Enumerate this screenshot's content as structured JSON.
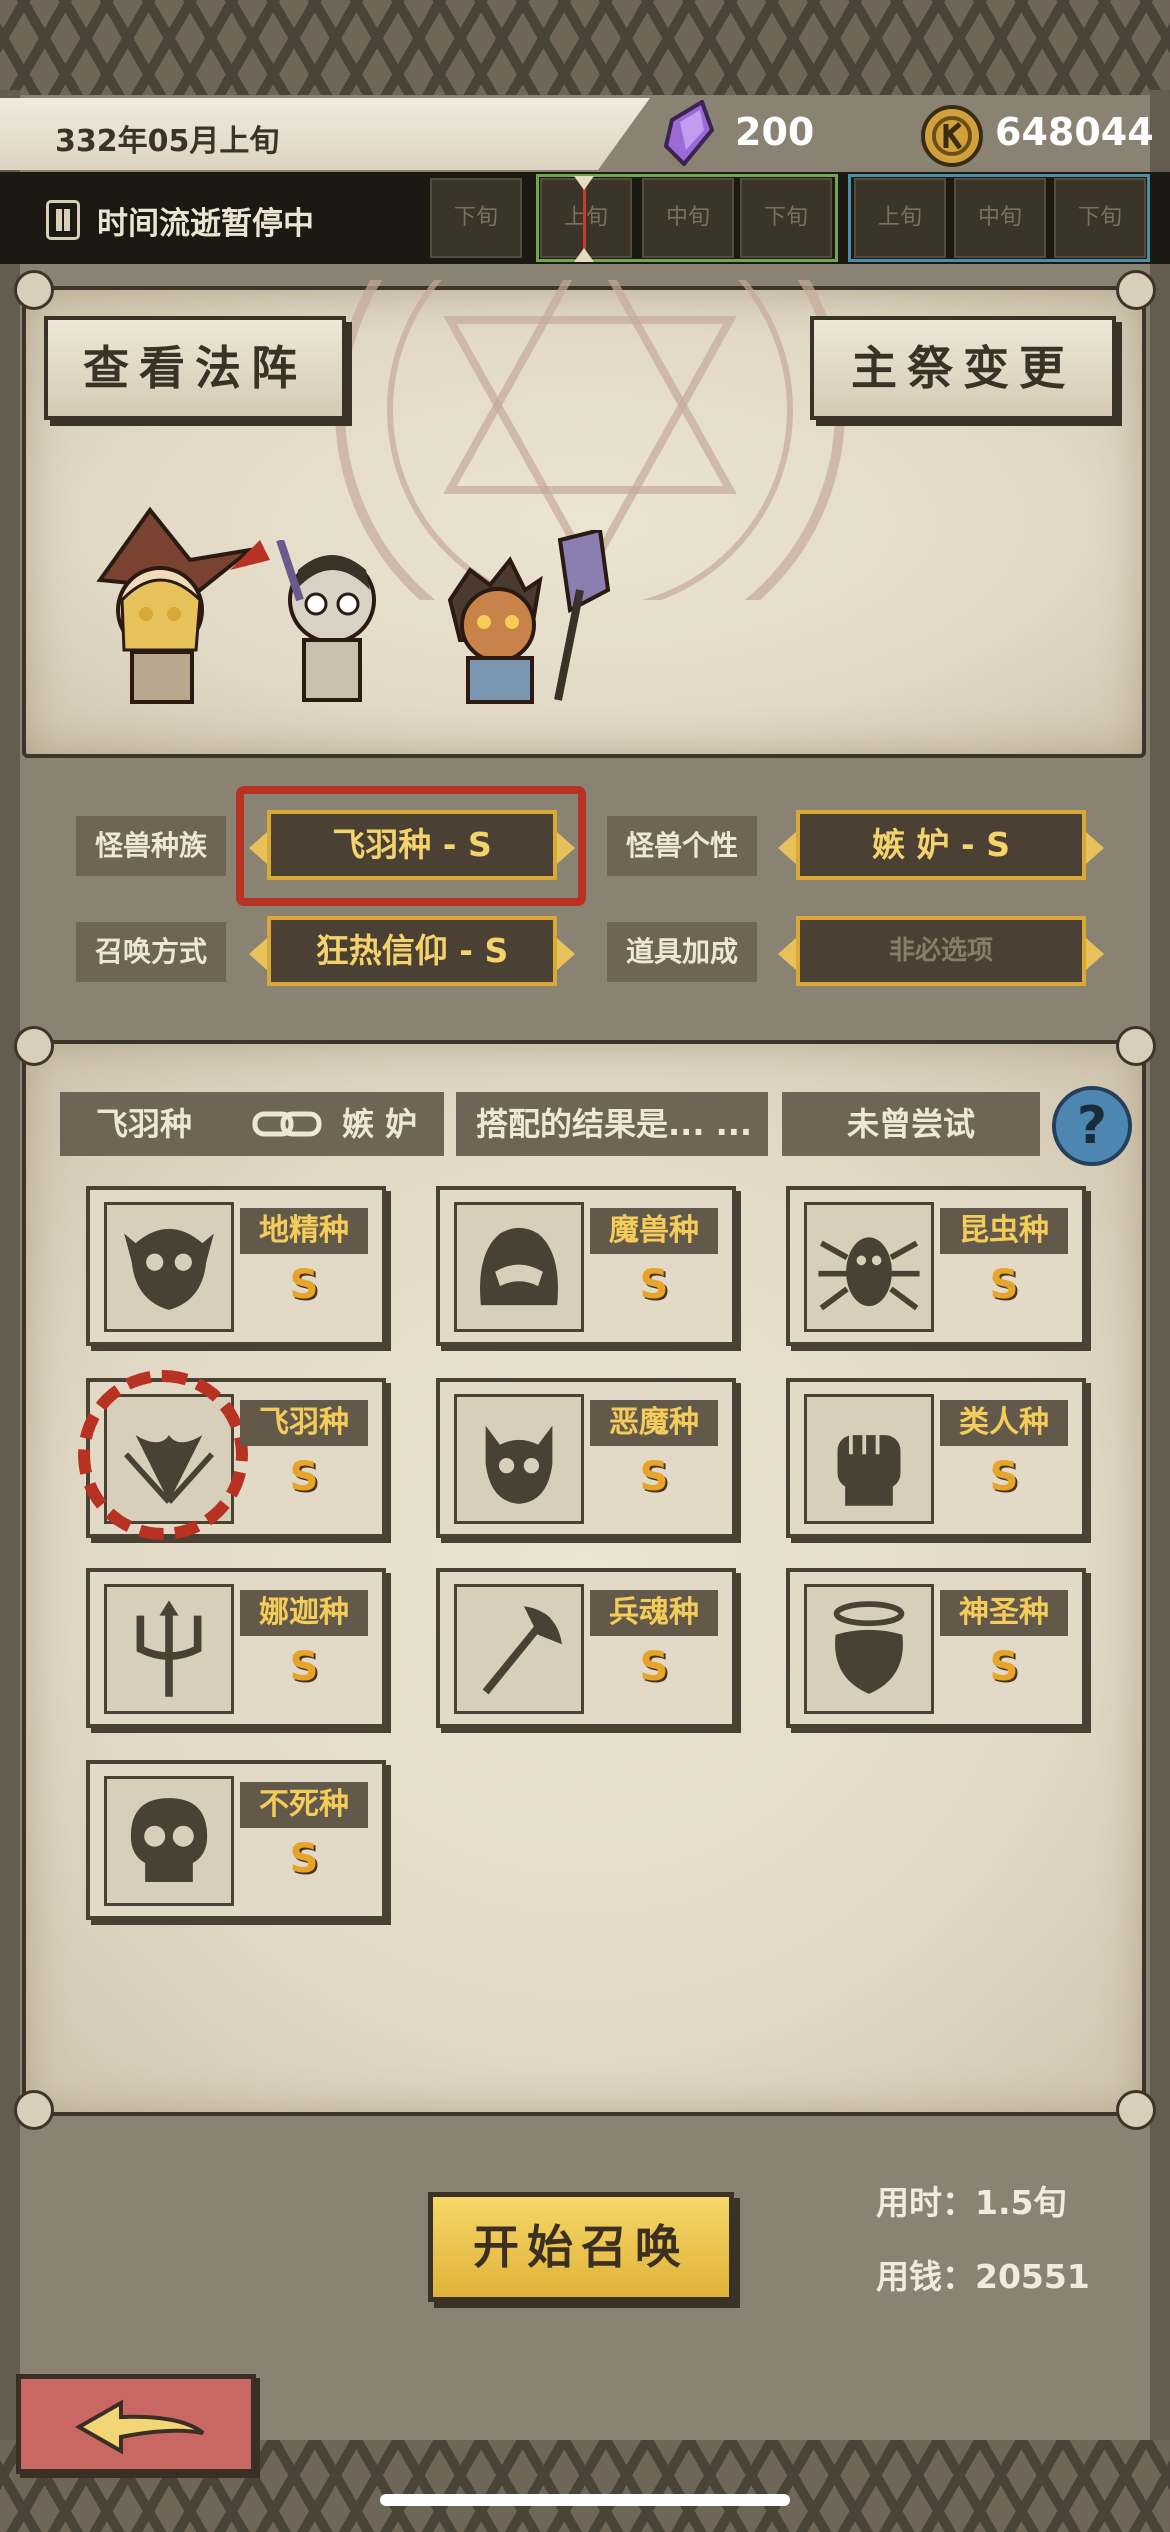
{
  "header": {
    "date": "332年05月上旬",
    "gems": "200",
    "coins": "648044"
  },
  "timebar": {
    "status": "时间流逝暂停中",
    "slots": [
      "下旬",
      "上旬",
      "中旬",
      "下旬",
      "上旬",
      "中旬",
      "下旬"
    ]
  },
  "altar": {
    "view_array_label": "查看法阵",
    "change_priest_label": "主祭变更"
  },
  "selectors": {
    "race_label": "怪兽种族",
    "race_value": "飞羽种 - S",
    "personality_label": "怪兽个性",
    "personality_value": "嫉 妒 - S",
    "method_label": "召唤方式",
    "method_value": "狂热信仰 - S",
    "item_label": "道具加成",
    "item_value": "非必选项"
  },
  "combo": {
    "left": "飞羽种",
    "right": "嫉 妒",
    "result": "搭配的结果是... ...",
    "status": "未曾尝试",
    "help": "?"
  },
  "species": [
    {
      "name": "地精种",
      "rank": "S",
      "icon": "goblin-icon"
    },
    {
      "name": "魔兽种",
      "rank": "S",
      "icon": "beast-icon"
    },
    {
      "name": "昆虫种",
      "rank": "S",
      "icon": "insect-icon"
    },
    {
      "name": "飞羽种",
      "rank": "S",
      "icon": "wing-icon",
      "selected": true
    },
    {
      "name": "恶魔种",
      "rank": "S",
      "icon": "demon-icon"
    },
    {
      "name": "类人种",
      "rank": "S",
      "icon": "fist-icon"
    },
    {
      "name": "娜迦种",
      "rank": "S",
      "icon": "trident-icon"
    },
    {
      "name": "兵魂种",
      "rank": "S",
      "icon": "axe-icon"
    },
    {
      "name": "神圣种",
      "rank": "S",
      "icon": "halo-icon"
    },
    {
      "name": "不死种",
      "rank": "S",
      "icon": "skull-icon"
    }
  ],
  "footer": {
    "start_label": "开始召唤",
    "time_cost": "用时：1.5旬",
    "money_cost": "用钱：20551"
  },
  "colors": {
    "gold": "#d9a937",
    "rank": "#e6a52a",
    "selection_red": "#b83224"
  }
}
